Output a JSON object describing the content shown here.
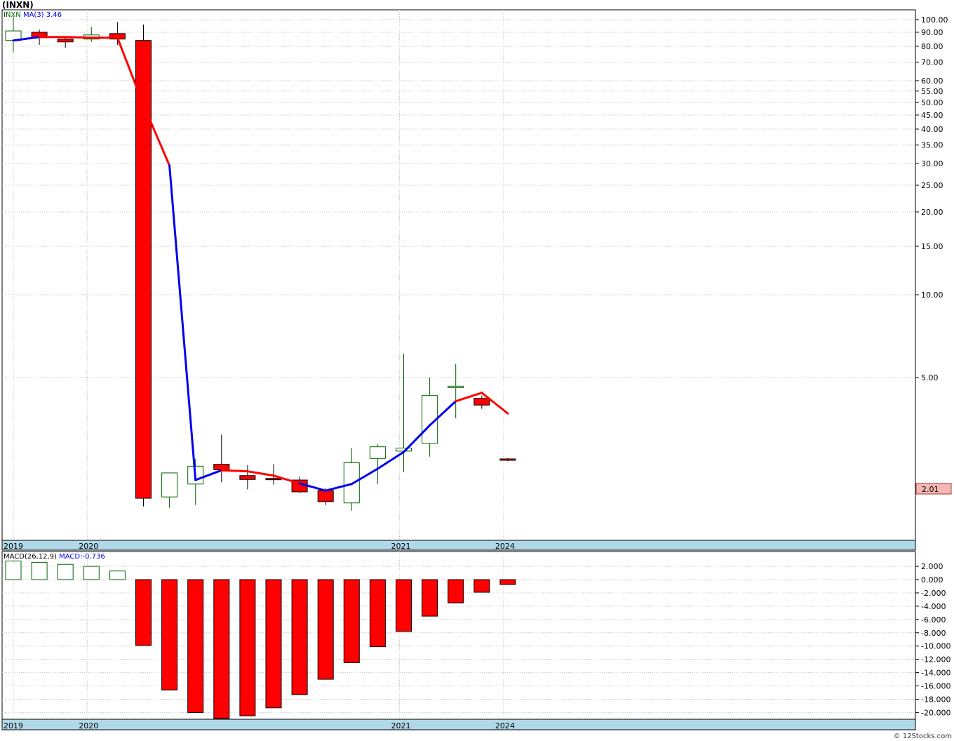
{
  "title": "(INXN)",
  "watermark": "© 12Stocks.com",
  "colors": {
    "up": "#006400",
    "down": "#ff0000",
    "ma_up": "#0000ee",
    "ma_down": "#ff0000",
    "grid": "#c0c0c0",
    "band": "#b0d8e8",
    "last_price_bg": "#f5b7b1"
  },
  "price_panel": {
    "legend_symbol": "INXN",
    "legend_ma": "MA(3)",
    "legend_ma_value": "3.46",
    "last_price_label": "2.01",
    "y_ticks": [
      "100.00",
      "90.00",
      "80.00",
      "70.00",
      "60.00",
      "55.00",
      "50.00",
      "45.00",
      "40.00",
      "35.00",
      "30.00",
      "25.00",
      "20.00",
      "15.00",
      "10.00",
      "5.00"
    ],
    "x_labels": [
      "2019",
      "2020",
      "2021",
      "2024"
    ]
  },
  "macd_panel": {
    "legend_macd": "MACD(26,12,9)",
    "legend_value": "MACD:-0.736",
    "y_ticks": [
      "2.000",
      "0.000",
      "-2.000",
      "-4.000",
      "-6.000",
      "-8.000",
      "-10.000",
      "-12.000",
      "-14.000",
      "-16.000",
      "-18.000",
      "-20.000"
    ],
    "x_labels": [
      "2019",
      "2020",
      "2021",
      "2024"
    ]
  },
  "chart_data": {
    "type": "candlestick",
    "title": "(INXN)",
    "y_scale": "log",
    "ylim": [
      1.6,
      110
    ],
    "candles": [
      {
        "open": 84,
        "high": 103,
        "low": 76,
        "close": 91
      },
      {
        "open": 90,
        "high": 92,
        "low": 81,
        "close": 86
      },
      {
        "open": 85,
        "high": 86,
        "low": 79,
        "close": 83
      },
      {
        "open": 85,
        "high": 94,
        "low": 83,
        "close": 88
      },
      {
        "open": 89,
        "high": 98,
        "low": 81,
        "close": 85
      },
      {
        "open": 84,
        "high": 96,
        "low": 1.7,
        "close": 1.82
      },
      {
        "open": 1.84,
        "high": 2.07,
        "low": 1.68,
        "close": 2.25
      },
      {
        "open": 2.05,
        "high": 2.53,
        "low": 1.72,
        "close": 2.38
      },
      {
        "open": 2.42,
        "high": 3.1,
        "low": 2.08,
        "close": 2.31
      },
      {
        "open": 2.2,
        "high": 2.4,
        "low": 1.96,
        "close": 2.13
      },
      {
        "open": 2.15,
        "high": 2.42,
        "low": 2.04,
        "close": 2.13
      },
      {
        "open": 2.12,
        "high": 2.18,
        "low": 1.9,
        "close": 1.92
      },
      {
        "open": 1.94,
        "high": 1.98,
        "low": 1.72,
        "close": 1.77
      },
      {
        "open": 1.75,
        "high": 2.77,
        "low": 1.64,
        "close": 2.45
      },
      {
        "open": 2.54,
        "high": 2.86,
        "low": 2.05,
        "close": 2.8
      },
      {
        "open": 2.7,
        "high": 6.1,
        "low": 2.26,
        "close": 2.77
      },
      {
        "open": 2.88,
        "high": 5.0,
        "low": 2.58,
        "close": 4.3
      },
      {
        "open": 4.6,
        "high": 5.6,
        "low": 3.55,
        "close": 4.65
      },
      {
        "open": 4.2,
        "high": 4.3,
        "low": 3.85,
        "close": 3.97
      },
      {
        "open": 2.53,
        "high": 2.55,
        "low": 2.48,
        "close": 2.51
      }
    ],
    "ma": [
      {
        "value": 84,
        "trend": "up"
      },
      {
        "value": 86.5,
        "trend": "up"
      },
      {
        "value": 86.5,
        "trend": "down"
      },
      {
        "value": 86,
        "trend": "down"
      },
      {
        "value": 86,
        "trend": "down"
      },
      {
        "value": 49,
        "trend": "down"
      },
      {
        "value": 29.5,
        "trend": "down"
      },
      {
        "value": 2.12,
        "trend": "up"
      },
      {
        "value": 2.3,
        "trend": "up"
      },
      {
        "value": 2.28,
        "trend": "down"
      },
      {
        "value": 2.2,
        "trend": "down"
      },
      {
        "value": 2.06,
        "trend": "down"
      },
      {
        "value": 1.94,
        "trend": "up"
      },
      {
        "value": 2.05,
        "trend": "up"
      },
      {
        "value": 2.33,
        "trend": "up"
      },
      {
        "value": 2.68,
        "trend": "up"
      },
      {
        "value": 3.35,
        "trend": "up"
      },
      {
        "value": 4.1,
        "trend": "up"
      },
      {
        "value": 4.4,
        "trend": "down"
      },
      {
        "value": 3.7,
        "trend": "down"
      }
    ],
    "macd": {
      "ylim": [
        -21,
        3
      ],
      "values": [
        2.8,
        2.6,
        2.3,
        2.0,
        1.3,
        -9.9,
        -16.6,
        -20.0,
        -20.9,
        -20.5,
        -19.3,
        -17.3,
        -15.0,
        -12.5,
        -10.1,
        -7.8,
        -5.5,
        -3.5,
        -1.9,
        -0.736
      ]
    },
    "x_labels": [
      {
        "label": "2019",
        "index": 0
      },
      {
        "label": "2020",
        "index": 3
      },
      {
        "label": "2021",
        "index": 15
      },
      {
        "label": "2024",
        "index": 19
      }
    ]
  }
}
